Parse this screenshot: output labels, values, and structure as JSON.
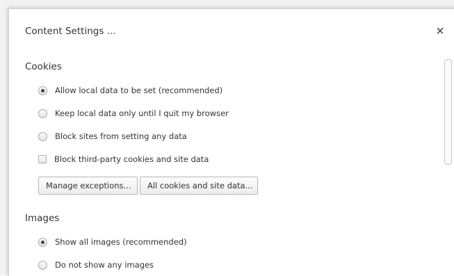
{
  "dialog": {
    "title": "Content Settings ...",
    "close_label": "×"
  },
  "cookies": {
    "heading": "Cookies",
    "options": [
      {
        "label": "Allow local data to be set (recommended)",
        "checked": true
      },
      {
        "label": "Keep local data only until I quit my browser",
        "checked": false
      },
      {
        "label": "Block sites from setting any data",
        "checked": false
      }
    ],
    "block_third_party": {
      "label": "Block third-party cookies and site data",
      "checked": false
    },
    "buttons": {
      "manage_exceptions": "Manage exceptions...",
      "all_cookies": "All cookies and site data..."
    }
  },
  "images": {
    "heading": "Images",
    "options": [
      {
        "label": "Show all images (recommended)",
        "checked": true
      },
      {
        "label": "Do not show any images",
        "checked": false
      }
    ]
  }
}
